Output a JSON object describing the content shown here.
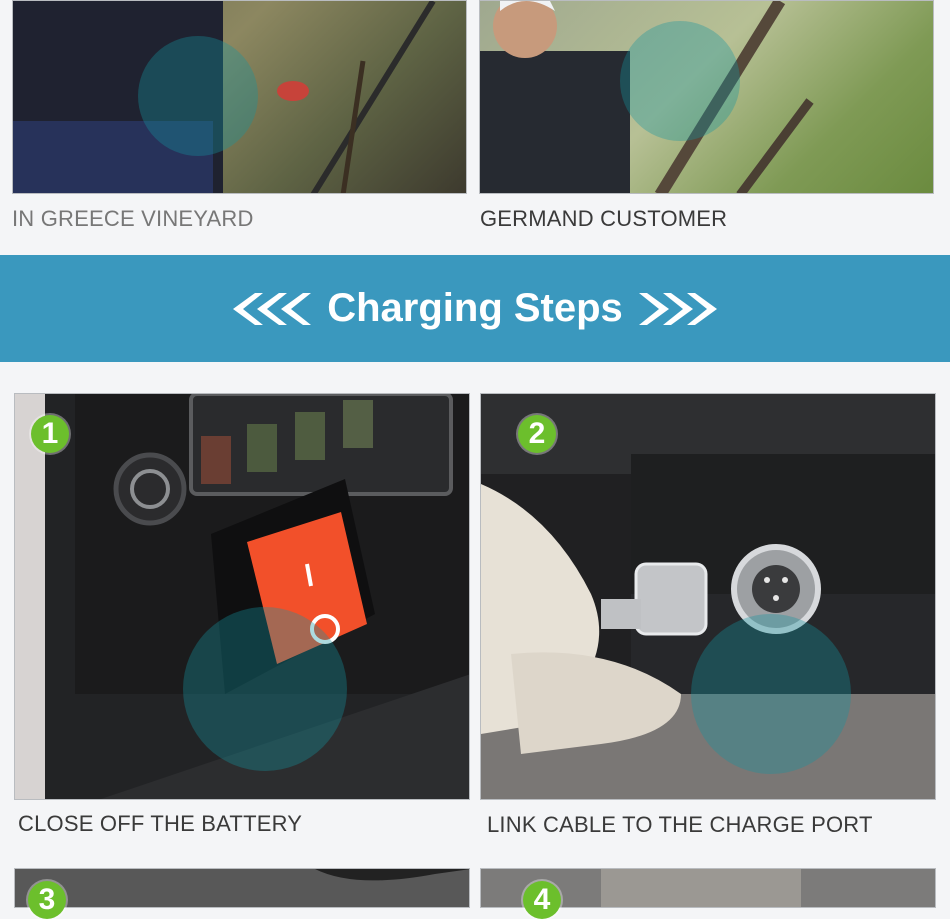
{
  "gallery": [
    {
      "caption": "IN GREECE VINEYARD"
    },
    {
      "caption": "GERMAND CUSTOMER"
    }
  ],
  "banner": {
    "title": "Charging Steps"
  },
  "steps": [
    {
      "number": "1",
      "caption": "CLOSE OFF THE BATTERY"
    },
    {
      "number": "2",
      "caption": "LINK CABLE TO THE CHARGE PORT"
    },
    {
      "number": "3",
      "caption": ""
    },
    {
      "number": "4",
      "caption": ""
    }
  ],
  "colors": {
    "banner": "#3a98be",
    "badge": "#6cbf2c",
    "switch": "#f2502a"
  }
}
